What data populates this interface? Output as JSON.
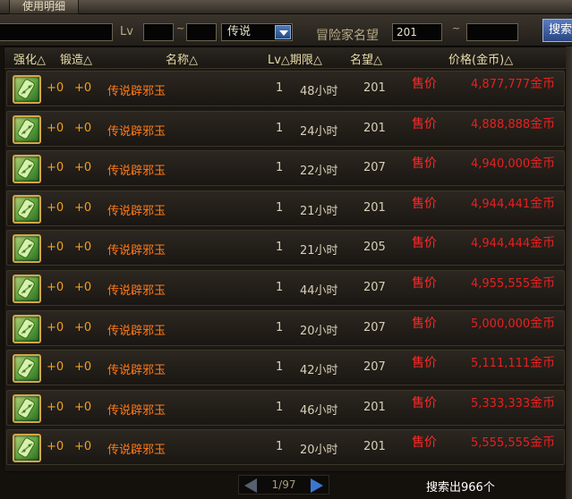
{
  "topbar": {
    "tab_label": "使用明细"
  },
  "filter": {
    "lv_label": "Lv",
    "lv_min": "",
    "lv_max": "",
    "tilde": "~",
    "rarity_selected": "传说",
    "fame_label": "冒险家名望",
    "fame_min": "201",
    "fame_max": "",
    "search_label": "搜索"
  },
  "columns": {
    "enhance": "强化△",
    "forge": "锻造△",
    "name": "名称△",
    "lv_term": "Lv△期限△",
    "fame": "名望△",
    "price": "价格(金币)△"
  },
  "rows": [
    {
      "enhance": "+0",
      "forge": "+0",
      "name": "传说辟邪玉",
      "lv": "1",
      "term": "48小时",
      "fame": "201",
      "sell": "售价",
      "price": "4,877,777",
      "unit": "金币"
    },
    {
      "enhance": "+0",
      "forge": "+0",
      "name": "传说辟邪玉",
      "lv": "1",
      "term": "24小时",
      "fame": "201",
      "sell": "售价",
      "price": "4,888,888",
      "unit": "金币"
    },
    {
      "enhance": "+0",
      "forge": "+0",
      "name": "传说辟邪玉",
      "lv": "1",
      "term": "22小时",
      "fame": "207",
      "sell": "售价",
      "price": "4,940,000",
      "unit": "金币"
    },
    {
      "enhance": "+0",
      "forge": "+0",
      "name": "传说辟邪玉",
      "lv": "1",
      "term": "21小时",
      "fame": "201",
      "sell": "售价",
      "price": "4,944,441",
      "unit": "金币"
    },
    {
      "enhance": "+0",
      "forge": "+0",
      "name": "传说辟邪玉",
      "lv": "1",
      "term": "21小时",
      "fame": "205",
      "sell": "售价",
      "price": "4,944,444",
      "unit": "金币"
    },
    {
      "enhance": "+0",
      "forge": "+0",
      "name": "传说辟邪玉",
      "lv": "1",
      "term": "44小时",
      "fame": "207",
      "sell": "售价",
      "price": "4,955,555",
      "unit": "金币"
    },
    {
      "enhance": "+0",
      "forge": "+0",
      "name": "传说辟邪玉",
      "lv": "1",
      "term": "20小时",
      "fame": "207",
      "sell": "售价",
      "price": "5,000,000",
      "unit": "金币"
    },
    {
      "enhance": "+0",
      "forge": "+0",
      "name": "传说辟邪玉",
      "lv": "1",
      "term": "42小时",
      "fame": "207",
      "sell": "售价",
      "price": "5,111,111",
      "unit": "金币"
    },
    {
      "enhance": "+0",
      "forge": "+0",
      "name": "传说辟邪玉",
      "lv": "1",
      "term": "46小时",
      "fame": "201",
      "sell": "售价",
      "price": "5,333,333",
      "unit": "金币"
    },
    {
      "enhance": "+0",
      "forge": "+0",
      "name": "传说辟邪玉",
      "lv": "1",
      "term": "20小时",
      "fame": "201",
      "sell": "售价",
      "price": "5,555,555",
      "unit": "金币"
    }
  ],
  "pager": {
    "text": "1/97"
  },
  "result_count": "搜索出966个",
  "colors": {
    "name": "#ff7a18",
    "enhance": "#f0a020",
    "price": "#e82020",
    "header": "#e8dca8"
  }
}
